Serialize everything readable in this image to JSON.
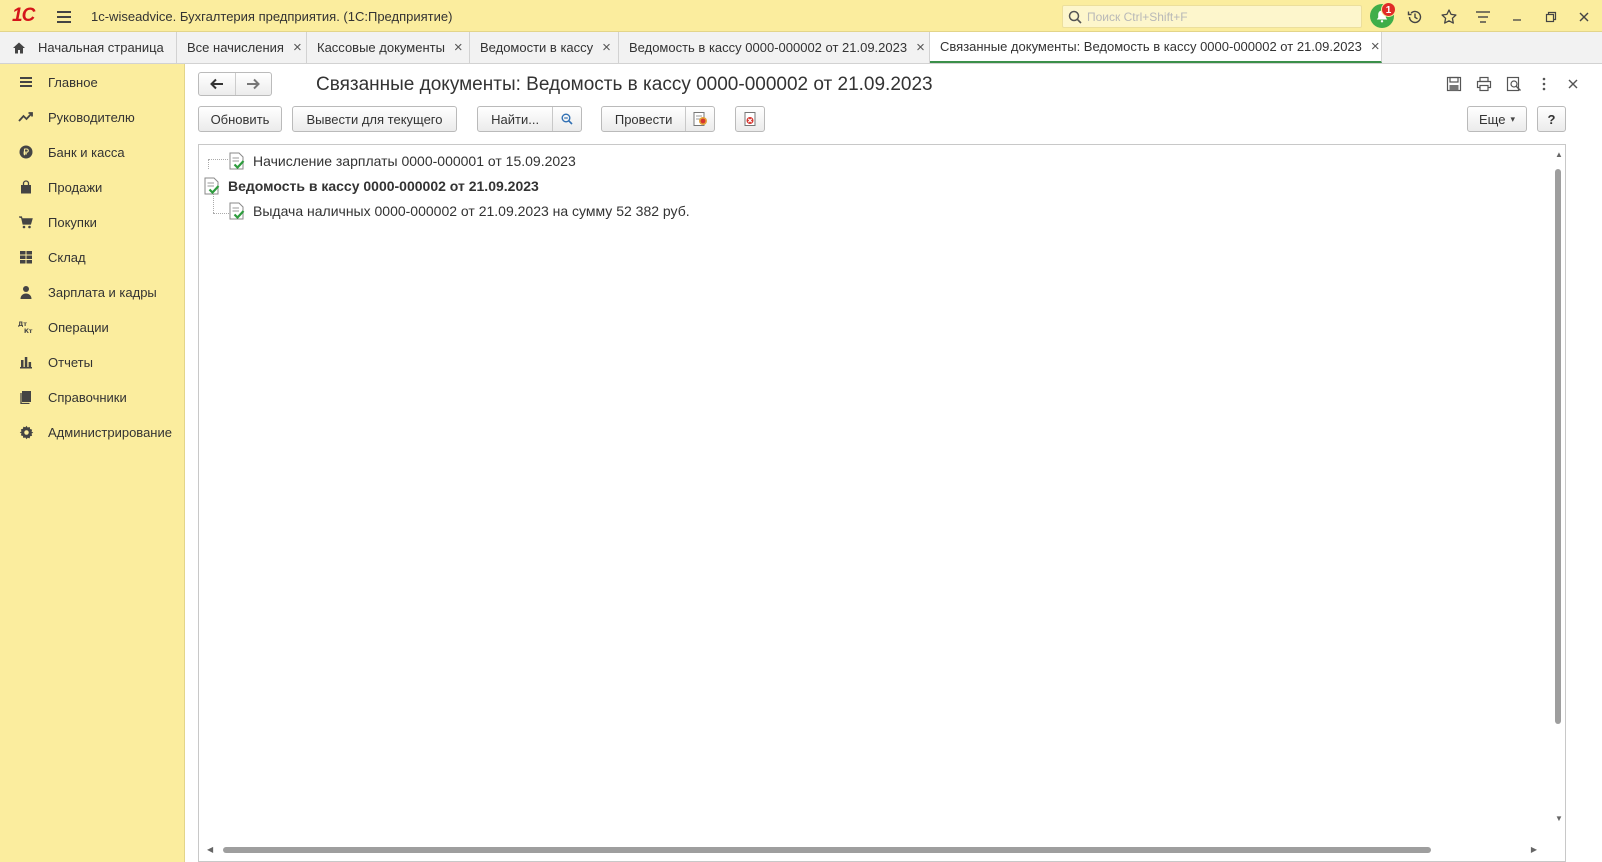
{
  "app": {
    "title": "1c-wiseadvice. Бухгалтерия предприятия.  (1С:Предприятие)",
    "logo_text": "1C",
    "search_placeholder": "Поиск Ctrl+Shift+F",
    "notification_count": "1"
  },
  "tabs": [
    {
      "label": "Начальная страница",
      "closable": false
    },
    {
      "label": "Все начисления",
      "closable": true
    },
    {
      "label": "Кассовые документы",
      "closable": true
    },
    {
      "label": "Ведомости в кассу",
      "closable": true
    },
    {
      "label": "Ведомость в кассу 0000-000002 от 21.09.2023",
      "closable": true
    },
    {
      "label": "Связанные документы: Ведомость в кассу 0000-000002 от 21.09.2023",
      "closable": true,
      "active": true
    }
  ],
  "tab_close_glyph": "×",
  "sidebar": {
    "items": [
      {
        "label": "Главное",
        "icon": "menu-icon"
      },
      {
        "label": "Руководителю",
        "icon": "trend-icon"
      },
      {
        "label": "Банк и касса",
        "icon": "ruble-icon"
      },
      {
        "label": "Продажи",
        "icon": "bag-icon"
      },
      {
        "label": "Покупки",
        "icon": "cart-icon"
      },
      {
        "label": "Склад",
        "icon": "warehouse-icon"
      },
      {
        "label": "Зарплата и кадры",
        "icon": "person-icon"
      },
      {
        "label": "Операции",
        "icon": "operations-icon"
      },
      {
        "label": "Отчеты",
        "icon": "report-icon"
      },
      {
        "label": "Справочники",
        "icon": "book-icon"
      },
      {
        "label": "Администрирование",
        "icon": "gear-icon"
      }
    ]
  },
  "form": {
    "title": "Связанные документы: Ведомость в кассу 0000-000002 от 21.09.2023",
    "toolbar": {
      "refresh_label": "Обновить",
      "show_for_current_label": "Вывести для текущего",
      "find_label": "Найти...",
      "post_label": "Провести",
      "more_label": "Еще",
      "more_caret": "▾",
      "help_label": "?"
    },
    "tree": [
      {
        "text": "Начисление зарплаты 0000-000001 от 15.09.2023",
        "level": 1,
        "bold": false
      },
      {
        "text": "Ведомость в кассу 0000-000002 от 21.09.2023",
        "level": 0,
        "bold": true
      },
      {
        "text": "Выдача наличных 0000-000002 от 21.09.2023 на сумму 52 382 руб.",
        "level": 1,
        "bold": false
      }
    ]
  },
  "colors": {
    "accent_yellow": "#fbed9e",
    "active_tab_underline": "#3b8f4a",
    "notification_green": "#3fae49",
    "badge_red": "#e02b27",
    "logo_red": "#d4151a"
  }
}
